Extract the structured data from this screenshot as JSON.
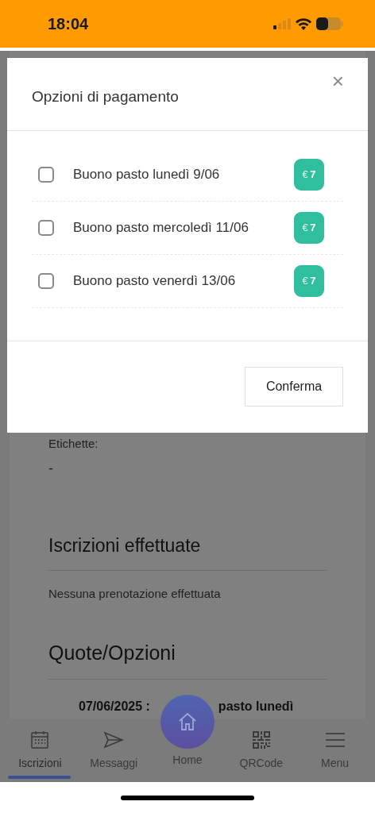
{
  "status_bar": {
    "time": "18:04"
  },
  "modal": {
    "title": "Opzioni di pagamento",
    "close": "×",
    "options": [
      {
        "label": "Buono pasto lunedì 9/06",
        "checked": false,
        "currency": "€",
        "price": "7"
      },
      {
        "label": "Buono pasto mercoledì 11/06",
        "checked": false,
        "currency": "€",
        "price": "7"
      },
      {
        "label": "Buono pasto venerdì 13/06",
        "checked": false,
        "currency": "€",
        "price": "7"
      }
    ],
    "confirm_button": "Conferma"
  },
  "background": {
    "labels_title": "Etichette:",
    "labels_value": "-",
    "subscriptions_heading": "Iscrizioni effettuate",
    "subscriptions_empty": "Nessuna prenotazione effettuata",
    "fees_heading": "Quote/Opzioni",
    "fee_item_start": "07/06/2025 :",
    "fee_item_end": "pasto lunedì"
  },
  "nav": [
    {
      "label": "Iscrizioni",
      "kind": "calendar",
      "selected": true
    },
    {
      "label": "Messaggi",
      "kind": "send",
      "selected": false
    },
    {
      "label": "Home",
      "kind": "home",
      "selected": false
    },
    {
      "label": "QRCode",
      "kind": "qr",
      "selected": false
    },
    {
      "label": "Menu",
      "kind": "menu",
      "selected": false
    }
  ]
}
